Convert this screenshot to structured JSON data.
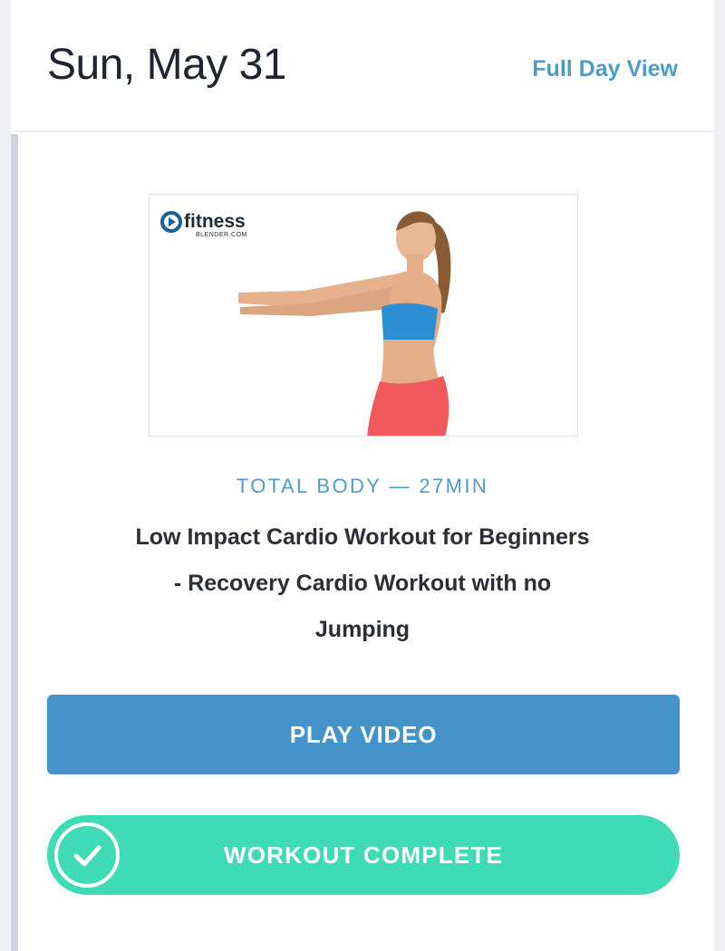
{
  "header": {
    "date": "Sun, May 31",
    "full_day_link": "Full Day View"
  },
  "workout": {
    "thumbnail": {
      "logo_text": "fitness",
      "logo_subtext": "BLENDER.COM"
    },
    "category_line": "TOTAL BODY — 27MIN",
    "title_line_1": "Low Impact Cardio Workout for Beginners",
    "title_line_2": "- Recovery Cardio Workout with no",
    "title_line_3": "Jumping"
  },
  "actions": {
    "play_label": "PLAY VIDEO",
    "complete_label": "WORKOUT COMPLETE"
  },
  "icons": {
    "complete": "check-circle-icon",
    "logo": "fitness-blender-logo-icon"
  },
  "colors": {
    "accent_blue": "#4392c9",
    "link_blue": "#4c9cc9",
    "complete_green": "#3fdbb6",
    "text_dark": "#1e2431"
  }
}
